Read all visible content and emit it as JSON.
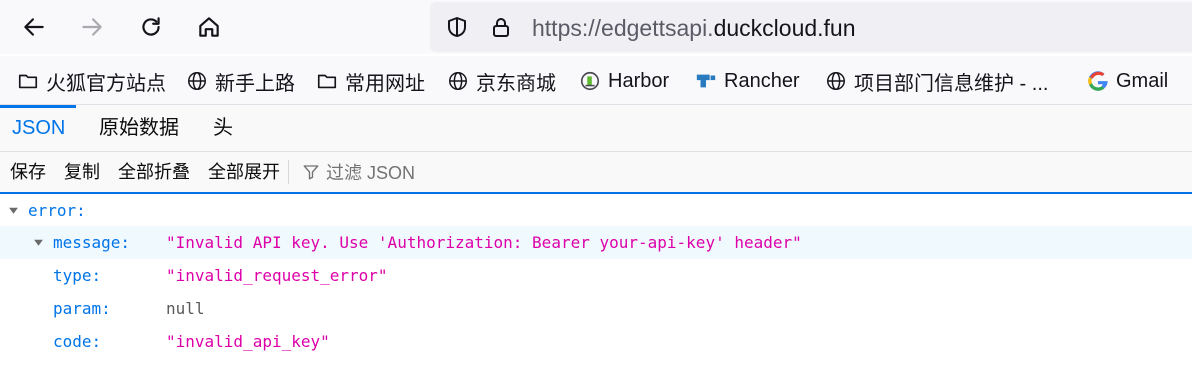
{
  "browser": {
    "url_prefix": "https://edgettsapi.",
    "url_domain": "duckcloud.fun"
  },
  "bookmarks": [
    {
      "label": "火狐官方站点",
      "icon": "folder-icon"
    },
    {
      "label": "新手上路",
      "icon": "globe-icon"
    },
    {
      "label": "常用网址",
      "icon": "folder-icon"
    },
    {
      "label": "京东商城",
      "icon": "globe-icon"
    },
    {
      "label": "Harbor",
      "icon": "harbor-icon"
    },
    {
      "label": "Rancher",
      "icon": "rancher-icon"
    },
    {
      "label": "项目部门信息维护 - ...",
      "icon": "globe-icon"
    },
    {
      "label": "Gmail",
      "icon": "google-icon"
    }
  ],
  "viewer": {
    "tabs": [
      "JSON",
      "原始数据",
      "头"
    ],
    "selected_tab": "JSON",
    "toolbar": {
      "save": "保存",
      "copy": "复制",
      "collapse_all": "全部折叠",
      "expand_all": "全部展开",
      "filter_placeholder": "过滤 JSON"
    }
  },
  "json_tree": {
    "root_key": "error:",
    "rows": [
      {
        "key": "message:",
        "value": "\"Invalid API key. Use 'Authorization: Bearer your-api-key' header\"",
        "type": "string"
      },
      {
        "key": "type:",
        "value": "\"invalid_request_error\"",
        "type": "string"
      },
      {
        "key": "param:",
        "value": "null",
        "type": "null"
      },
      {
        "key": "code:",
        "value": "\"invalid_api_key\"",
        "type": "string"
      }
    ]
  },
  "colors": {
    "accent": "#0074e8",
    "string_value": "#dd00a9",
    "selected_row": "#f0f9fe"
  }
}
